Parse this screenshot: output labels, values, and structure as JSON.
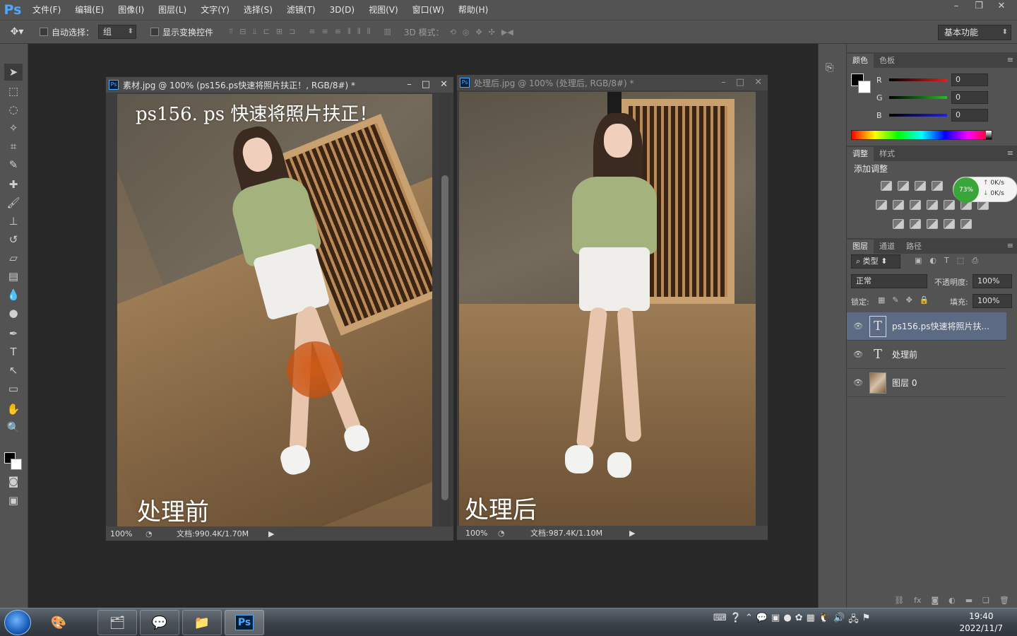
{
  "app": {
    "logo": "Ps",
    "menu": [
      "文件(F)",
      "编辑(E)",
      "图像(I)",
      "图层(L)",
      "文字(Y)",
      "选择(S)",
      "滤镜(T)",
      "3D(D)",
      "视图(V)",
      "窗口(W)",
      "帮助(H)"
    ],
    "window_controls": [
      "–",
      "❐",
      "✕"
    ]
  },
  "options_bar": {
    "auto_select_label": "自动选择：",
    "auto_select_value": "组",
    "show_transform_label": "显示变换控件",
    "mode_3d_label": "3D 模式：",
    "workspace": "基本功能"
  },
  "documents": [
    {
      "title": "素材.jpg @ 100% (ps156.ps快速将照片扶正！, RGB/8#) *",
      "top_text": "ps156. ps 快速将照片扶正！",
      "caption": "处理前",
      "zoom": "100%",
      "doc_size": "文档:990.4K/1.70M"
    },
    {
      "title": "处理后.jpg @ 100% (处理后, RGB/8#) *",
      "caption": "处理后",
      "zoom": "100%",
      "doc_size": "文档:987.4K/1.10M"
    }
  ],
  "color_panel": {
    "tabs": [
      "颜色",
      "色板"
    ],
    "channels": [
      {
        "label": "R",
        "value": "0",
        "color": "#e02020"
      },
      {
        "label": "G",
        "value": "0",
        "color": "#20c020"
      },
      {
        "label": "B",
        "value": "0",
        "color": "#2020e0"
      }
    ]
  },
  "adjust_panel": {
    "tabs": [
      "调整",
      "样式"
    ],
    "title": "添加调整",
    "net_meter": {
      "percent": "73%",
      "up": "0K/s",
      "down": "0K/s"
    }
  },
  "layers_panel": {
    "tabs": [
      "图层",
      "通道",
      "路径"
    ],
    "filter_type": "类型",
    "blend_mode": "正常",
    "opacity_label": "不透明度:",
    "opacity": "100%",
    "lock_label": "锁定:",
    "fill_label": "填充:",
    "fill": "100%",
    "layers": [
      {
        "name": "ps156.ps快速将照片扶...",
        "kind": "text",
        "selected": true
      },
      {
        "name": "处理前",
        "kind": "text",
        "selected": false
      },
      {
        "name": "图层 0",
        "kind": "image",
        "selected": false
      }
    ]
  },
  "taskbar": {
    "time": "19:40",
    "date": "2022/11/7"
  }
}
